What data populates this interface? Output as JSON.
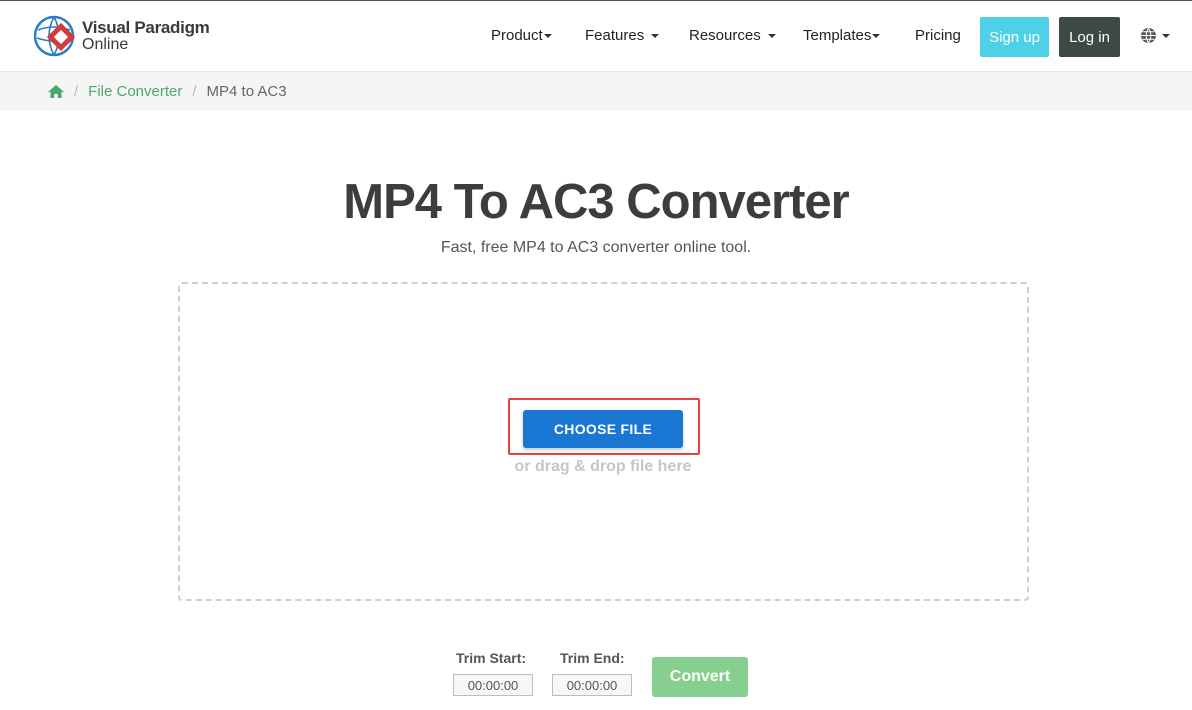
{
  "logo": {
    "line1": "Visual Paradigm",
    "line2": "Online"
  },
  "nav": {
    "items": [
      {
        "label": "Product",
        "has_caret": true
      },
      {
        "label": "Features",
        "has_caret": true
      },
      {
        "label": "Resources",
        "has_caret": true
      },
      {
        "label": "Templates",
        "has_caret": true
      },
      {
        "label": "Pricing",
        "has_caret": false
      }
    ],
    "signup_label": "Sign up",
    "login_label": "Log in",
    "language_icon": "globe-icon"
  },
  "breadcrumb": {
    "home_icon": "home-icon",
    "link": "File Converter",
    "current": "MP4 to AC3"
  },
  "main": {
    "title": "MP4 To AC3 Converter",
    "subtitle": "Fast, free MP4 to AC3 converter online tool.",
    "choose_file_label": "CHOOSE FILE",
    "drag_hint": "or drag & drop file here"
  },
  "trim": {
    "start_label": "Trim Start:",
    "start_value": "00:00:00",
    "end_label": "Trim End:",
    "end_value": "00:00:00",
    "convert_label": "Convert"
  },
  "colors": {
    "signup": "#4dd0e8",
    "login": "#3d4a44",
    "link": "#4aa86a",
    "choose_file": "#1976d2",
    "highlight": "#e0443a",
    "convert": "#86cf8f"
  }
}
